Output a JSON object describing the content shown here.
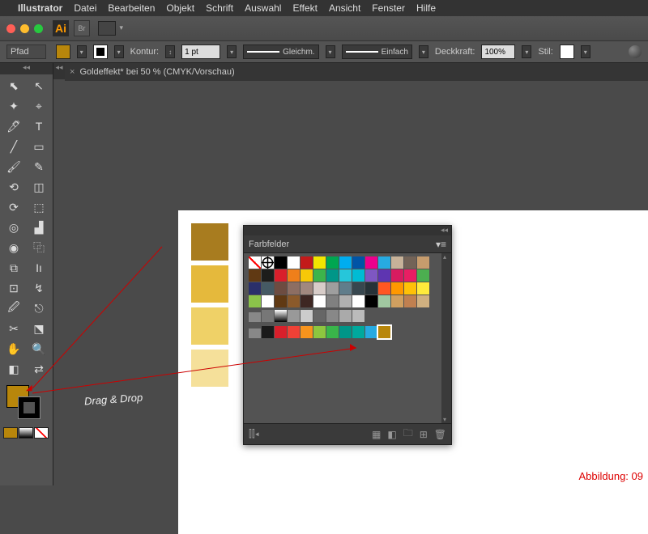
{
  "menubar": {
    "app": "Illustrator",
    "items": [
      "Datei",
      "Bearbeiten",
      "Objekt",
      "Schrift",
      "Auswahl",
      "Effekt",
      "Ansicht",
      "Fenster",
      "Hilfe"
    ]
  },
  "titlebar": {
    "ai": "Ai",
    "br": "Br"
  },
  "opt": {
    "pfad": "Pfad",
    "kontur": "Kontur:",
    "pt": "1 pt",
    "gleich": "Gleichm.",
    "einfach": "Einfach",
    "deck": "Deckkraft:",
    "deckval": "100%",
    "stil": "Stil:"
  },
  "colors": {
    "fill": "#b8860b",
    "stroke": "#000000"
  },
  "doc": {
    "tab": "Goldeffekt* bei 50 % (CMYK/Vorschau)"
  },
  "gold": [
    "#a87c1f",
    "#e5b93c",
    "#efd167",
    "#f5e09a"
  ],
  "panel": {
    "title": "Farbfelder"
  },
  "swatches_main": [
    "#ffffff",
    "#ffffff",
    "#000000",
    "#ffffff",
    "#c31a1a",
    "#f2e600",
    "#00a651",
    "#00adef",
    "#0054a6",
    "#ec008c",
    "#27aae1",
    "#c7b299",
    "#736357",
    "#c69c6d",
    "#603913",
    "#1d1d1b",
    "#d91f2b",
    "#ef7f1a",
    "#f7c808",
    "#3cb44b",
    "#009688",
    "#26c6da",
    "#00bcd4",
    "#7e57c2",
    "#5e35b1",
    "#d81b60",
    "#e91e63",
    "#4caf50",
    "#2a2f6a",
    "#455a64",
    "#6d4c41",
    "#8d6e63",
    "#a1887f",
    "#d7ccc8",
    "#9e9e9e",
    "#607d8b",
    "#37474f",
    "#263238",
    "#ff5722",
    "#ff9800",
    "#ffc107",
    "#ffeb3b",
    "#8bc34a",
    "#ffffff",
    "#603913",
    "#8b5a2b",
    "#3e2723",
    "#ffffff",
    "#808080",
    "#b0b0b0",
    "#ffffff",
    "#000000",
    "#a0c8a0",
    "#d0a060",
    "#c08050",
    "#d0b080"
  ],
  "swatches_row2": [
    "#1a1a1a",
    "#d91f2b",
    "#ef4136",
    "#f7941d",
    "#8dc63f",
    "#39b54a",
    "#009688",
    "#00a99d",
    "#27aae1",
    "#b8860b"
  ],
  "annot": {
    "drag": "Drag & Drop"
  },
  "caption": "Abbildung: 09"
}
